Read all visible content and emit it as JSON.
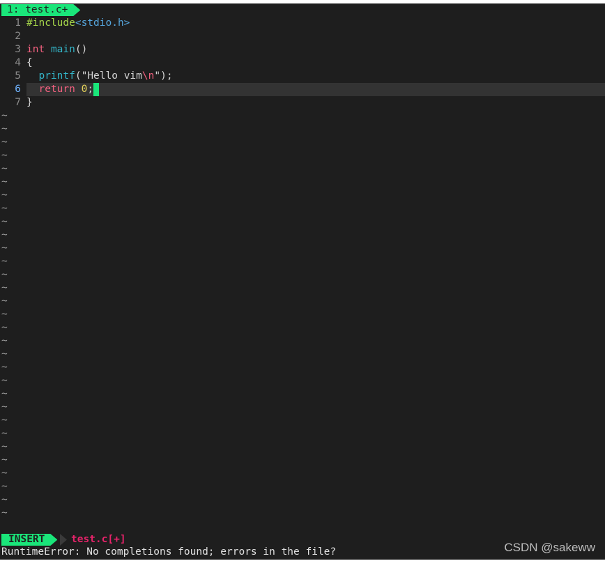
{
  "tabline": {
    "tab_label": "1: test.c+"
  },
  "editor": {
    "lines": [
      {
        "number": "1",
        "code": [
          {
            "cls": "pp",
            "text": "#include"
          },
          {
            "cls": "inc",
            "text": "<stdio.h>"
          }
        ]
      },
      {
        "number": "2",
        "code": []
      },
      {
        "number": "3",
        "code": [
          {
            "cls": "kw",
            "text": "int"
          },
          {
            "cls": "",
            "text": " "
          },
          {
            "cls": "fn",
            "text": "main"
          },
          {
            "cls": "",
            "text": "()"
          }
        ]
      },
      {
        "number": "4",
        "code": [
          {
            "cls": "",
            "text": "{"
          }
        ]
      },
      {
        "number": "5",
        "code": [
          {
            "cls": "",
            "text": "  "
          },
          {
            "cls": "fn",
            "text": "printf"
          },
          {
            "cls": "",
            "text": "("
          },
          {
            "cls": "str",
            "text": "\"Hello vim"
          },
          {
            "cls": "esc",
            "text": "\\n"
          },
          {
            "cls": "str",
            "text": "\""
          },
          {
            "cls": "",
            "text": ");"
          }
        ]
      },
      {
        "number": "6",
        "cursorline": true,
        "code": [
          {
            "cls": "",
            "text": "  "
          },
          {
            "cls": "kw",
            "text": "return"
          },
          {
            "cls": "",
            "text": " "
          },
          {
            "cls": "num-lit",
            "text": "0"
          },
          {
            "cls": "",
            "text": ";"
          }
        ]
      },
      {
        "number": "7",
        "code": [
          {
            "cls": "",
            "text": "}"
          }
        ]
      }
    ],
    "empty_line_marker": "~",
    "empty_line_count": 31
  },
  "statusline": {
    "mode": "INSERT",
    "filename": "test.c[+]"
  },
  "cmdline": {
    "message": "RuntimeError: No completions found; errors in the file?"
  },
  "watermark": {
    "text": "CSDN @sakeww"
  },
  "colors": {
    "background": "#1e1e1e",
    "accent_green": "#1ae67a",
    "filename_pink": "#e8236b",
    "keyword": "#f2607f",
    "function": "#33b5c8"
  }
}
